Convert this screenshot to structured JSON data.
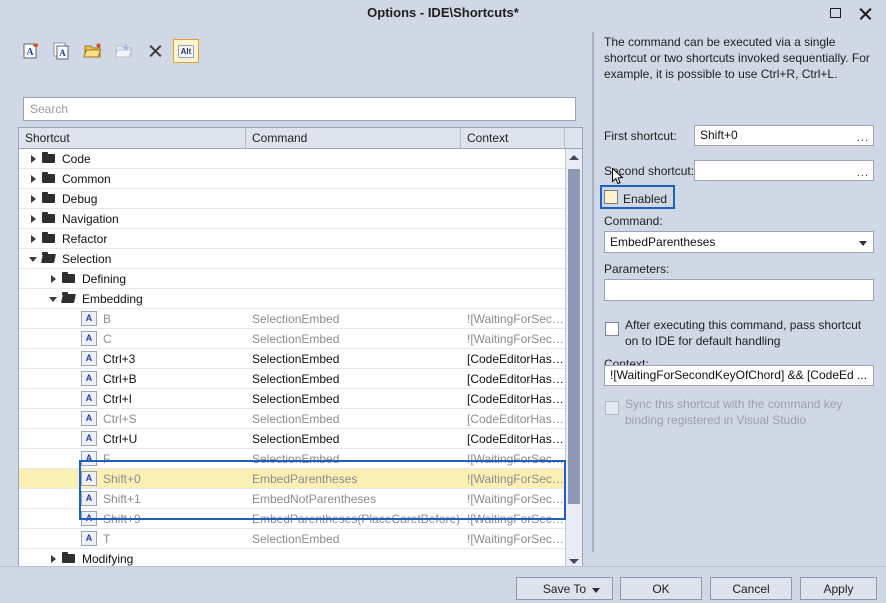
{
  "window": {
    "title": "Options - IDE\\Shortcuts*",
    "maximize_icon": "maximize-icon",
    "close_icon": "close-icon"
  },
  "toolbar": {
    "items": [
      {
        "name": "new-shortcut-icon",
        "glyph": "A"
      },
      {
        "name": "copy-shortcut-icon",
        "glyph": "A"
      },
      {
        "name": "import-folder-icon",
        "glyph": "folder"
      },
      {
        "name": "export-folder-icon",
        "glyph": "folder"
      },
      {
        "name": "delete-icon",
        "glyph": "x"
      },
      {
        "name": "alt-toggle-icon",
        "glyph": "Alt"
      }
    ],
    "alt_label": "Alt"
  },
  "search": {
    "placeholder": "Search",
    "value": ""
  },
  "grid": {
    "columns": [
      "Shortcut",
      "Command",
      "Context"
    ],
    "rows": [
      {
        "type": "folder",
        "indent": 0,
        "expanded": false,
        "shortcut": "Code",
        "command": "",
        "context": "",
        "dim": false
      },
      {
        "type": "folder",
        "indent": 0,
        "expanded": false,
        "shortcut": "Common",
        "command": "",
        "context": "",
        "dim": false
      },
      {
        "type": "folder",
        "indent": 0,
        "expanded": false,
        "shortcut": "Debug",
        "command": "",
        "context": "",
        "dim": false
      },
      {
        "type": "folder",
        "indent": 0,
        "expanded": false,
        "shortcut": "Navigation",
        "command": "",
        "context": "",
        "dim": false
      },
      {
        "type": "folder",
        "indent": 0,
        "expanded": false,
        "shortcut": "Refactor",
        "command": "",
        "context": "",
        "dim": false
      },
      {
        "type": "folder",
        "indent": 0,
        "expanded": true,
        "shortcut": "Selection",
        "command": "",
        "context": "",
        "dim": false
      },
      {
        "type": "folder",
        "indent": 1,
        "expanded": false,
        "shortcut": "Defining",
        "command": "",
        "context": "",
        "dim": false
      },
      {
        "type": "folder",
        "indent": 1,
        "expanded": true,
        "shortcut": "Embedding",
        "command": "",
        "context": "",
        "dim": false
      },
      {
        "type": "item",
        "indent": 2,
        "shortcut": "B",
        "command": "SelectionEmbed",
        "context": "![WaitingForSeco...",
        "dim": true,
        "highlight": false
      },
      {
        "type": "item",
        "indent": 2,
        "shortcut": "C",
        "command": "SelectionEmbed",
        "context": "![WaitingForSeco...",
        "dim": true,
        "highlight": false
      },
      {
        "type": "item",
        "indent": 2,
        "shortcut": "Ctrl+3",
        "command": "SelectionEmbed",
        "context": "[CodeEditorHasF...",
        "dim": false,
        "highlight": false
      },
      {
        "type": "item",
        "indent": 2,
        "shortcut": "Ctrl+B",
        "command": "SelectionEmbed",
        "context": "[CodeEditorHasF...",
        "dim": false,
        "highlight": false
      },
      {
        "type": "item",
        "indent": 2,
        "shortcut": "Ctrl+I",
        "command": "SelectionEmbed",
        "context": "[CodeEditorHasF...",
        "dim": false,
        "highlight": false
      },
      {
        "type": "item",
        "indent": 2,
        "shortcut": "Ctrl+S",
        "command": "SelectionEmbed",
        "context": "[CodeEditorHasF...",
        "dim": true,
        "highlight": false
      },
      {
        "type": "item",
        "indent": 2,
        "shortcut": "Ctrl+U",
        "command": "SelectionEmbed",
        "context": "[CodeEditorHasF...",
        "dim": false,
        "highlight": false
      },
      {
        "type": "item",
        "indent": 2,
        "shortcut": "F",
        "command": "SelectionEmbed",
        "context": "![WaitingForSeco...",
        "dim": true,
        "highlight": false
      },
      {
        "type": "item",
        "indent": 2,
        "shortcut": "Shift+0",
        "command": "EmbedParentheses",
        "context": "![WaitingForSeco...",
        "dim": true,
        "highlight": true
      },
      {
        "type": "item",
        "indent": 2,
        "shortcut": "Shift+1",
        "command": "EmbedNotParentheses",
        "context": "![WaitingForSeco...",
        "dim": true,
        "highlight": false
      },
      {
        "type": "item",
        "indent": 2,
        "shortcut": "Shift+9",
        "command": "EmbedParentheses(PlaceCaretBefore)",
        "context": "![WaitingForSeco...",
        "dim": true,
        "highlight": false
      },
      {
        "type": "item",
        "indent": 2,
        "shortcut": "T",
        "command": "SelectionEmbed",
        "context": "![WaitingForSeco...",
        "dim": true,
        "highlight": false
      },
      {
        "type": "folder",
        "indent": 1,
        "expanded": false,
        "shortcut": "Modifying",
        "command": "",
        "context": "",
        "dim": false
      }
    ],
    "key_badge": "A",
    "scroll_up_icon": "scroll-up-arrow-icon",
    "scroll_down_icon": "scroll-down-arrow-icon"
  },
  "details": {
    "description": "The command can be executed via a single shortcut or two shortcuts invoked sequentially. For example, it is possible to use Ctrl+R, Ctrl+L.",
    "first_shortcut_label": "First shortcut:",
    "first_shortcut_value": "Shift+0",
    "first_shortcut_browse": "...",
    "second_shortcut_label": "Second shortcut:",
    "second_shortcut_value": "",
    "second_shortcut_browse": "...",
    "enabled_label": "Enabled",
    "enabled_checked": false,
    "command_label": "Command:",
    "command_value": "EmbedParentheses",
    "parameters_label": "Parameters:",
    "parameters_value": "",
    "pass_shortcut_label": "After executing this command, pass shortcut on to IDE for default handling",
    "pass_shortcut_checked": false,
    "context_label": "Context:",
    "context_value": "![WaitingForSecondKeyOfChord] && [CodeEd  ...",
    "sync_label": "Sync this shortcut with the command key binding registered in Visual Studio",
    "sync_checked": false,
    "sync_disabled": true
  },
  "footer": {
    "save_to": "Save To",
    "ok": "OK",
    "cancel": "Cancel",
    "apply": "Apply"
  },
  "colors": {
    "window_bg": "#d0d7e5",
    "focus_blue": "#1f5fbf",
    "highlight_yellow": "#fbf0b4",
    "grid_header": "#dfe3ee"
  }
}
